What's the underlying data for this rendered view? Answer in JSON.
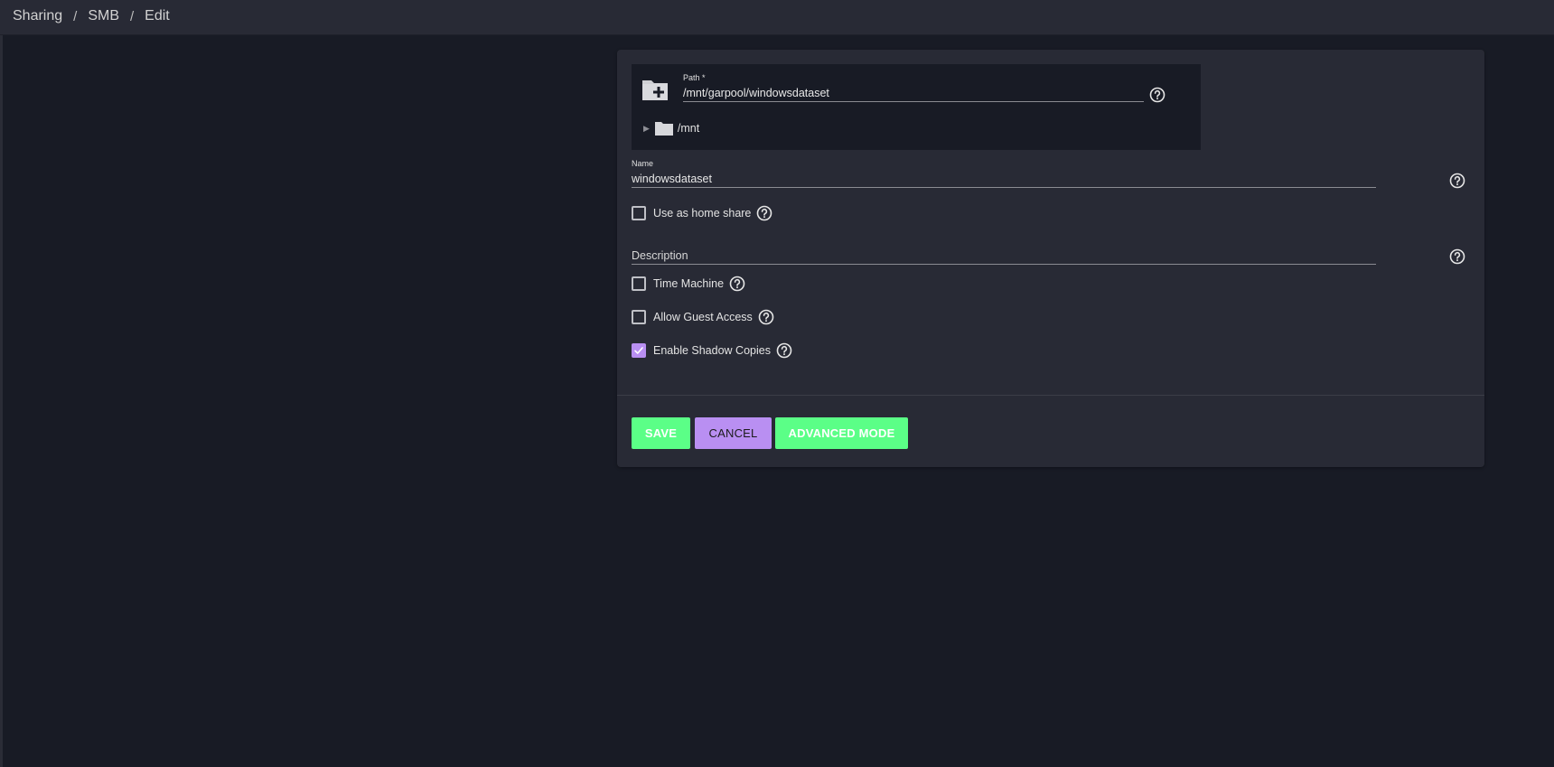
{
  "breadcrumb": {
    "items": [
      "Sharing",
      "SMB",
      "Edit"
    ],
    "separator": "/"
  },
  "form": {
    "path": {
      "label": "Path *",
      "value": "/mnt/garpool/windowsdataset",
      "tree_root": "/mnt"
    },
    "name": {
      "label": "Name",
      "value": "windowsdataset"
    },
    "home_share": {
      "label": "Use as home share",
      "checked": false
    },
    "description": {
      "placeholder": "Description",
      "value": ""
    },
    "time_machine": {
      "label": "Time Machine",
      "checked": false
    },
    "guest_access": {
      "label": "Allow Guest Access",
      "checked": false
    },
    "shadow_copies": {
      "label": "Enable Shadow Copies",
      "checked": true
    }
  },
  "actions": {
    "save_label": "SAVE",
    "cancel_label": "CANCEL",
    "advanced_label": "ADVANCED MODE"
  },
  "icons": {
    "folder_add": "folder-plus-icon",
    "folder": "folder-icon",
    "help": "help-circle-icon",
    "expand": "triangle-right-icon",
    "check": "check-icon"
  },
  "colors": {
    "background": "#181b25",
    "card": "#282a35",
    "accent_green": "#5bff87",
    "accent_purple": "#b98ff2"
  }
}
